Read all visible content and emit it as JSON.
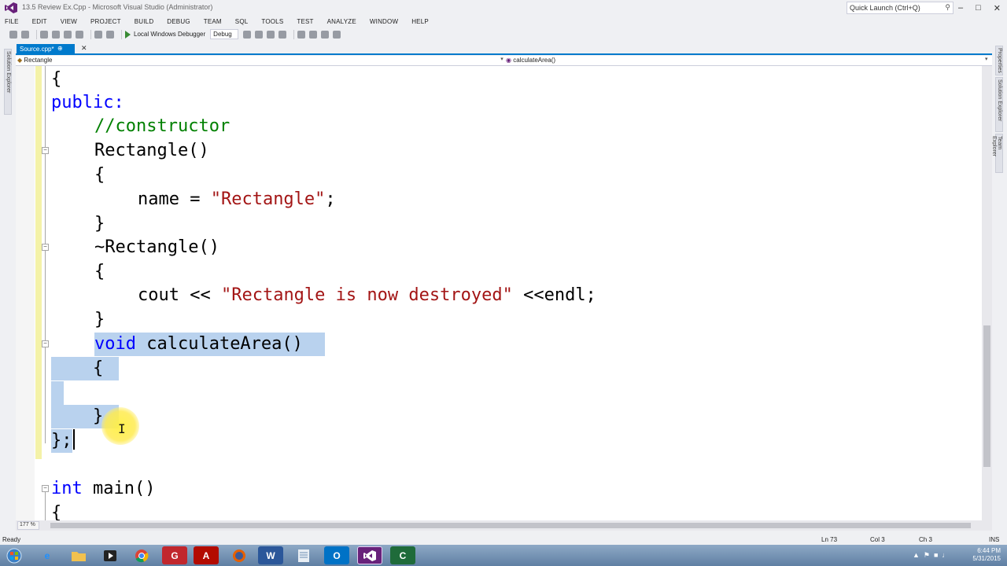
{
  "window": {
    "title": "13.5 Review Ex.Cpp - Microsoft Visual Studio (Administrator)",
    "quick_launch_placeholder": "Quick Launch (Ctrl+Q)"
  },
  "menu": [
    "FILE",
    "EDIT",
    "VIEW",
    "PROJECT",
    "BUILD",
    "DEBUG",
    "TEAM",
    "SQL",
    "TOOLS",
    "TEST",
    "ANALYZE",
    "WINDOW",
    "HELP"
  ],
  "toolbar": {
    "debugger_label": "Local Windows Debugger",
    "config_value": "Debug"
  },
  "tabs": {
    "active": "Source.cpp*"
  },
  "nav": {
    "scope": "Rectangle",
    "member": "calculateArea()"
  },
  "side_tabs": {
    "left": "Solution Explorer",
    "right_1": "Properties",
    "right_2": "Solution Explorer",
    "right_3": "Team Explorer"
  },
  "code": {
    "l1": "{",
    "l2": "public:",
    "l3_comment": "//constructor",
    "l4": "Rectangle()",
    "l5": "{",
    "l6_a": "name = ",
    "l6_str": "\"Rectangle\"",
    "l6_b": ";",
    "l7": "}",
    "l8": "~Rectangle()",
    "l9": "{",
    "l10_a": "cout << ",
    "l10_str": "\"Rectangle is now destroyed\"",
    "l10_b": " <<endl;",
    "l11": "}",
    "l12_kw": "void",
    "l12_rest": " calculateArea()",
    "l13": "{",
    "l15": "}",
    "l16": "};",
    "l18_kw": "int",
    "l18_rest": " main()",
    "l19": "{"
  },
  "editor": {
    "zoom": "177 %"
  },
  "status": {
    "message": "Ready",
    "line": "Ln 73",
    "col": "Col 3",
    "ch": "Ch 3",
    "mode": "INS"
  },
  "clock": {
    "time": "6:44 PM",
    "date": "5/31/2015"
  },
  "colors": {
    "accent": "#007acc",
    "selection": "#b9d2ee",
    "keyword": "#0000ff",
    "comment": "#008000",
    "string": "#a31515"
  }
}
